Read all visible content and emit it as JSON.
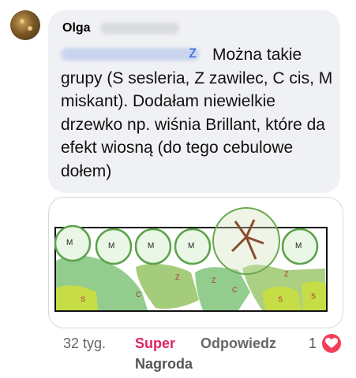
{
  "comment": {
    "author": "Olga",
    "mention_tail": "z",
    "text": "Można takie grupy (S sesleria, Z zawilec, C cis, M miskant). Dodałam niewielkie drzewko np. wiśnia Brillant, które da efekt wiosną (do tego cebulowe dołem)"
  },
  "drawing": {
    "labels": [
      "M",
      "M",
      "M",
      "M",
      "M",
      "Z",
      "C",
      "Z",
      "C",
      "S",
      "S",
      "Z",
      "S"
    ]
  },
  "actions": {
    "time": "32 tyg.",
    "super_line1": "Super",
    "super_line2": "Nagroda",
    "reply": "Odpowiedz",
    "reaction_count": "1"
  },
  "colors": {
    "bubble": "#f0f1f4",
    "super": "#e0245e",
    "heart": "#f33e58",
    "mention": "#3b6fd8"
  }
}
